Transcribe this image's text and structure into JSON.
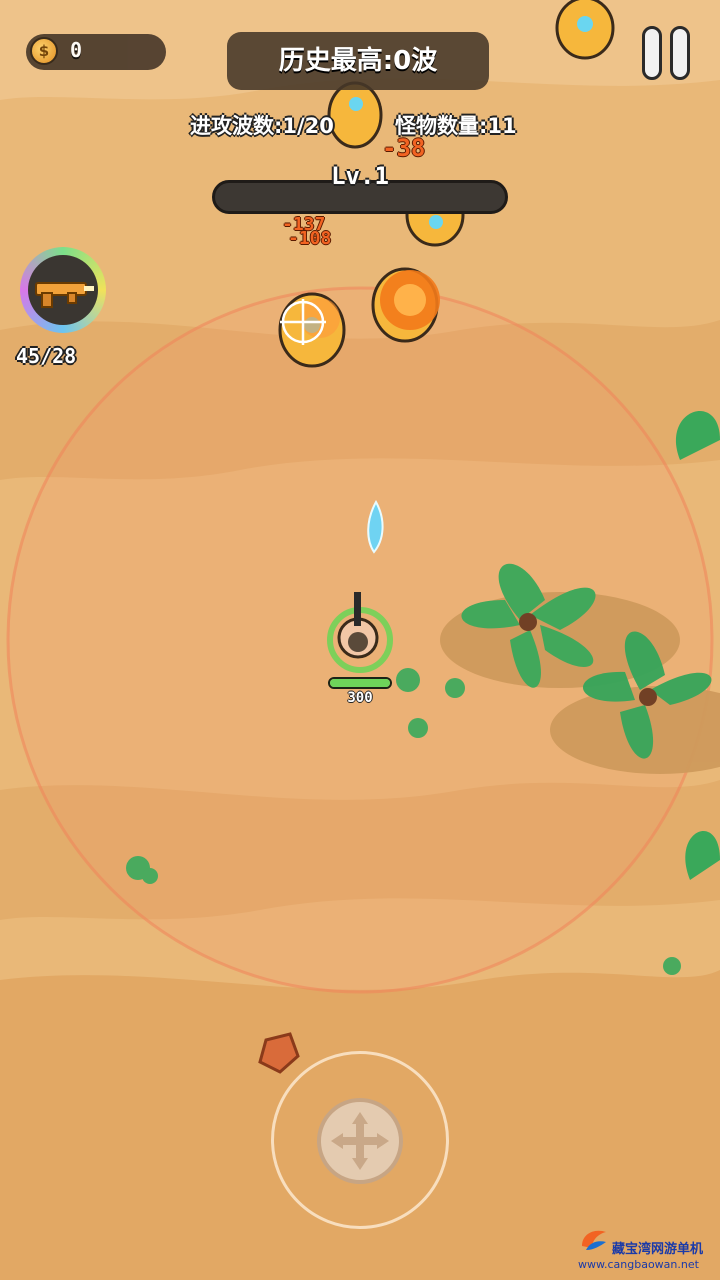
{
  "hud": {
    "coins": "0",
    "coin_symbol": "$",
    "best_record": "历史最高:0波",
    "wave_label": "进攻波数:1/20",
    "monster_label": "怪物数量:11",
    "level": "Lv.1",
    "level_progress": 0
  },
  "weapon": {
    "ammo": "45/28",
    "icon": "golden-rifle-icon"
  },
  "player": {
    "hp": "300",
    "hp_fraction": 1.0
  },
  "damage_numbers": [
    "-38",
    "-137",
    "-108"
  ],
  "controls": {
    "pause_icon": "pause-icon",
    "joystick_icon": "dpad-arrows-icon"
  },
  "watermark": {
    "name": "藏宝湾网游单机",
    "url": "www.cangbaowan.net"
  },
  "colors": {
    "sand": "#e9b878",
    "damage": "#f26322",
    "hp": "#6ed45a",
    "range_ring": "#f0845a"
  }
}
